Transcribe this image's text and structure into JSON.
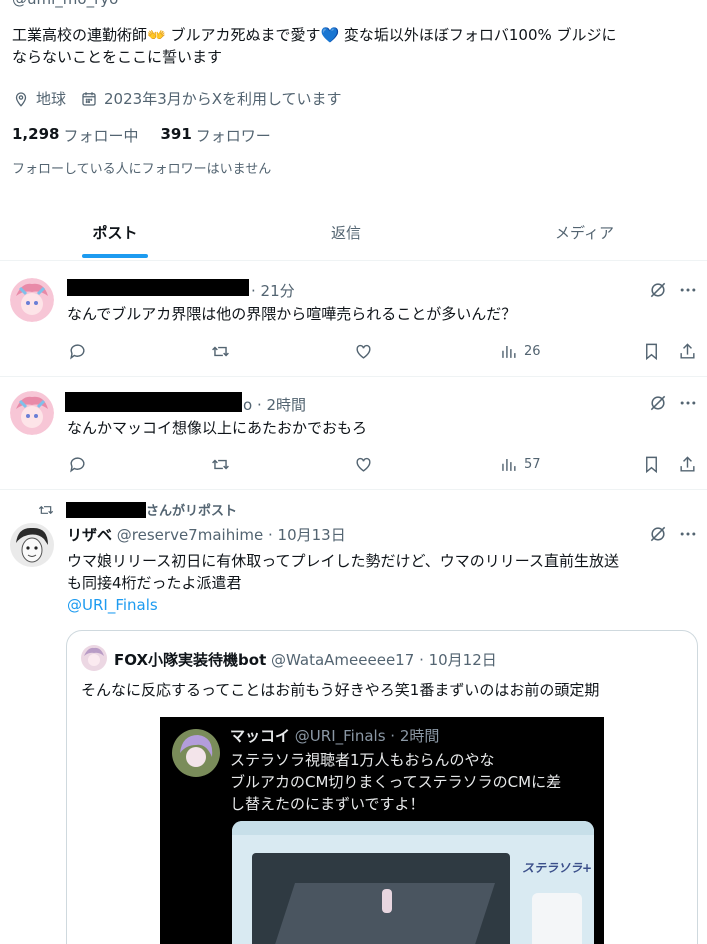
{
  "profile": {
    "handle_partial": "@umi_mo_ryo",
    "bio_line1": "工業高校の連勤術師👐 ブルアカ死ぬまで愛す💙 変な垢以外ほぼフォロバ100% ブルジに",
    "bio_line2": "ならないことをここに誓います",
    "location": "地球",
    "joined": "2023年3月からXを利用しています",
    "following_count": "1,298",
    "following_label": "フォロー中",
    "followers_count": "391",
    "followers_label": "フォロワー",
    "no_mutual_text": "フォローしている人にフォロワーはいません"
  },
  "tabs": [
    {
      "label": "ポスト",
      "active": true
    },
    {
      "label": "返信",
      "active": false
    },
    {
      "label": "メディア",
      "active": false
    }
  ],
  "posts": [
    {
      "time": "· 21分",
      "text": "なんでブルアカ界隈は他の界隈から喧嘩売られることが多いんだ？",
      "views": "26"
    },
    {
      "time": "· 2時間",
      "name_suffix": "o",
      "text": "なんかマッコイ想像以上にあたおかでおもろ",
      "views": "57"
    }
  ],
  "repost": {
    "label": "さんがリポスト",
    "name": "リザベ",
    "handle": "@reserve7maihime",
    "time": "· 10月13日",
    "text_line1": "ウマ娘リリース初日に有休取ってプレイした勢だけど、ウマのリリース直前生放送",
    "text_line2": "も同接4桁だったよ派遣君",
    "mention": "@URI_Finals",
    "quote": {
      "name": "FOX小隊実装待機bot",
      "handle": "@WataAmeeeee17",
      "time": "· 10月12日",
      "text": "そんなに反応するってことはお前もう好きやろ笑1番まずいのはお前の頭定期",
      "media": {
        "name": "マッコイ",
        "handle": "@URI_Finals",
        "time": "· 2時間",
        "line1": "ステラソラ視聴者1万人もおらんのやな",
        "line2": "ブルアカのCM切りまくってステラソラのCMに差",
        "line3": "し替えたのにまずいですよ！",
        "game_logo": "ステラソラ+"
      }
    }
  },
  "colors": {
    "accent": "#1d9bf0",
    "text": "#0f1419",
    "muted": "#536471",
    "border": "#eff3f4"
  }
}
